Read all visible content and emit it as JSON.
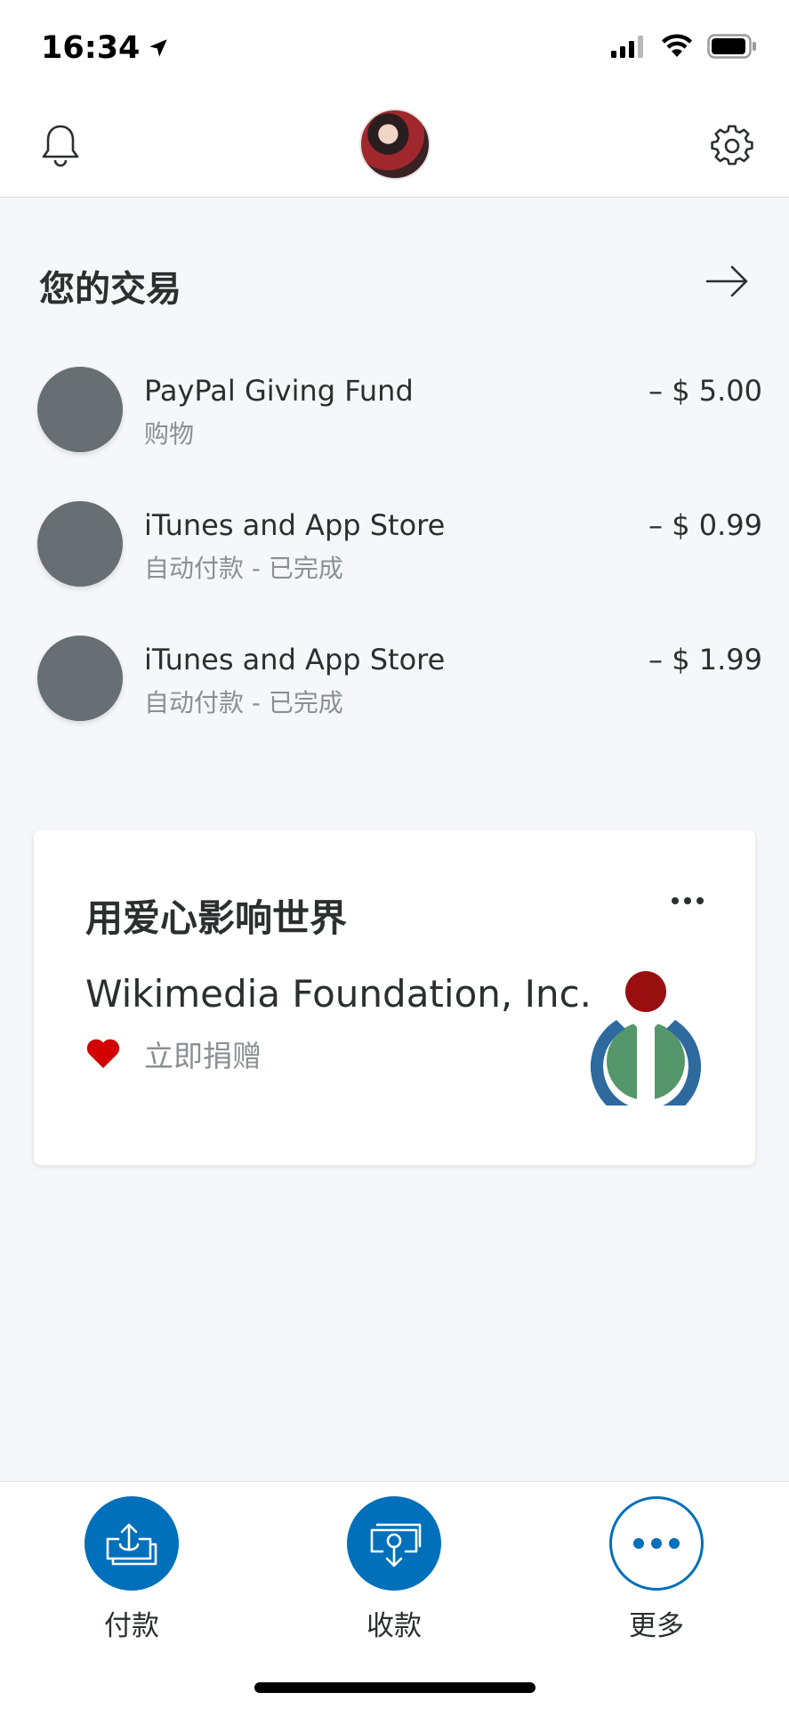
{
  "status_bar": {
    "time": "16:34"
  },
  "header": {
    "bell_icon": "bell-icon",
    "settings_icon": "gear-icon",
    "avatar": "profile-avatar"
  },
  "transactions": {
    "title": "您的交易",
    "items": [
      {
        "name": "PayPal Giving Fund",
        "subtitle": "购物",
        "amount": "– $ 5.00"
      },
      {
        "name": "iTunes and App Store",
        "subtitle": "自动付款 - 已完成",
        "amount": "– $ 0.99"
      },
      {
        "name": "iTunes and App Store",
        "subtitle": "自动付款 - 已完成",
        "amount": "– $ 1.99"
      }
    ]
  },
  "donation_card": {
    "title": "用爱心影响世界",
    "organization": "Wikimedia Foundation, Inc.",
    "donate_label": "立即捐赠",
    "logo": "wikimedia-logo"
  },
  "bottom_nav": {
    "pay_label": "付款",
    "receive_label": "收款",
    "more_label": "更多"
  },
  "colors": {
    "brand_blue": "#0070ba",
    "background": "#f5f7fa",
    "heart_red": "#d20000",
    "txn_circle": "#676f73"
  }
}
